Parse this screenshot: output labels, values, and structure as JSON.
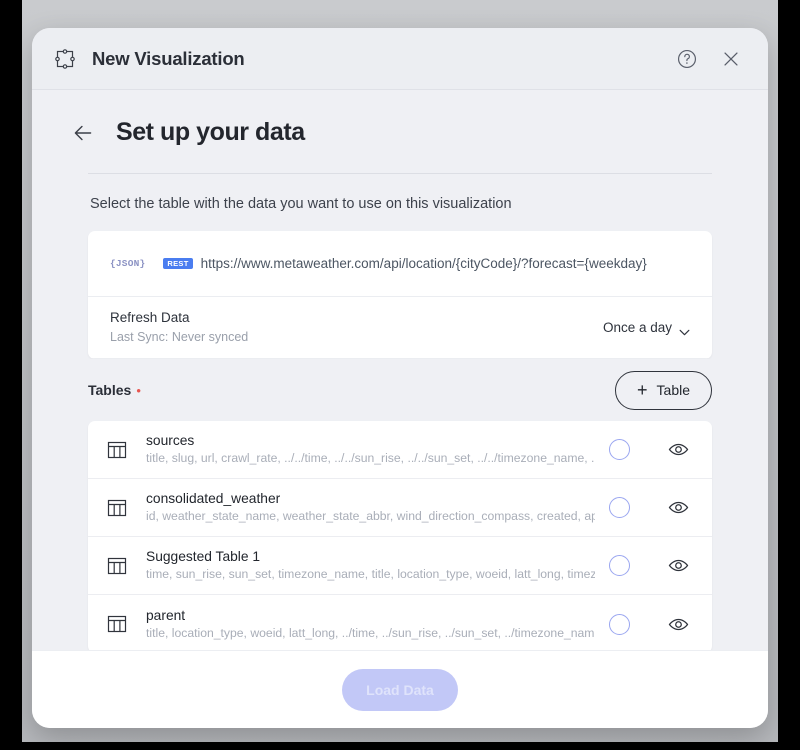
{
  "window": {
    "title": "New Visualization",
    "app_icon": "selection-frame-icon",
    "help_icon": "help-circle-icon",
    "close_icon": "close-icon"
  },
  "page": {
    "back_icon": "arrow-left-icon",
    "title": "Set up your data",
    "subtitle": "Select the table with the data you want to use on this visualization"
  },
  "source": {
    "format_badge": "{JSON}",
    "method_badge": "REST",
    "url": "https://www.metaweather.com/api/location/{cityCode}/?forecast={weekday}"
  },
  "refresh": {
    "title": "Refresh Data",
    "subtitle": "Last Sync: Never synced",
    "selected_option": "Once a day",
    "chevron_icon": "chevron-down-icon"
  },
  "tables_section": {
    "label": "Tables",
    "required_marker": "•",
    "add_button": {
      "plus": "+",
      "label": "Table"
    }
  },
  "tables": [
    {
      "name": "sources",
      "columns": "title, slug, url, crawl_rate, ../../time, ../../sun_rise, ../../sun_set, ../../timezone_name, ../....",
      "icon": "table-grid-icon",
      "radio_icon": "radio-unselected-icon",
      "preview_icon": "eye-icon"
    },
    {
      "name": "consolidated_weather",
      "columns": "id, weather_state_name, weather_state_abbr, wind_direction_compass, created, applic…",
      "icon": "table-grid-icon",
      "radio_icon": "radio-unselected-icon",
      "preview_icon": "eye-icon"
    },
    {
      "name": "Suggested Table 1",
      "columns": "time, sun_rise, sun_set, timezone_name, title, location_type, woeid, latt_long, timezone,…",
      "icon": "table-grid-icon",
      "radio_icon": "radio-unselected-icon",
      "preview_icon": "eye-icon"
    },
    {
      "name": "parent",
      "columns": "title, location_type, woeid, latt_long, ../time, ../sun_rise, ../sun_set, ../timezone_name, ~",
      "icon": "table-grid-icon",
      "radio_icon": "radio-unselected-icon",
      "preview_icon": "eye-icon"
    }
  ],
  "footer": {
    "load_button": "Load Data"
  },
  "colors": {
    "accent_blue": "#4a7df0",
    "radio_border": "#9aa6f0",
    "disabled_button_bg": "#c2c8f7",
    "disabled_button_text": "#dfe3fb",
    "required_marker": "#e8554f",
    "modal_bg": "#eff0f4",
    "card_bg": "#ffffff",
    "backdrop": "#b9bbbf"
  }
}
